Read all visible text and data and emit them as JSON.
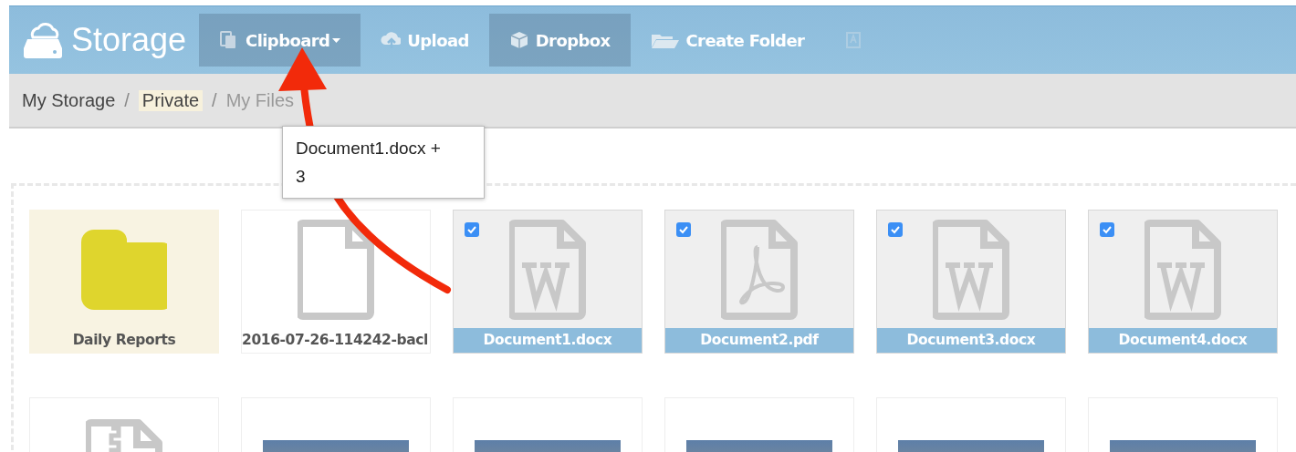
{
  "brand": {
    "title": "Storage"
  },
  "toolbar": [
    {
      "kind": "clipboard",
      "label": "Clipboard",
      "dropdown": true,
      "highlighted": true
    },
    {
      "kind": "upload",
      "label": "Upload",
      "dropdown": false,
      "highlighted": false
    },
    {
      "kind": "box",
      "label": "Dropbox",
      "dropdown": false,
      "highlighted": true
    },
    {
      "kind": "folder",
      "label": "Create Folder",
      "dropdown": false,
      "highlighted": false
    },
    {
      "kind": "translate",
      "highlighted": false,
      "disabled": true
    }
  ],
  "breadcrumb": [
    {
      "kind": "link",
      "label": "My Storage",
      "highlighted": false,
      "current": false
    },
    {
      "kind": "separator",
      "label": "/"
    },
    {
      "kind": "link",
      "label": "Private",
      "highlighted": true,
      "current": false
    },
    {
      "kind": "separator",
      "label": "/"
    },
    {
      "kind": "link",
      "label": "My Files",
      "highlighted": false,
      "current": true
    }
  ],
  "tooltip": {
    "text": "Document1.docx + 3"
  },
  "tiles": [
    {
      "kind": "folder",
      "label": "Daily Reports",
      "selected": false
    },
    {
      "kind": "file",
      "label": "2016-07-26-114242-bacl",
      "selected": false
    },
    {
      "kind": "word",
      "label": "Document1.docx",
      "selected": true
    },
    {
      "kind": "pdf",
      "label": "Document2.pdf",
      "selected": true
    },
    {
      "kind": "word",
      "label": "Document3.docx",
      "selected": true
    },
    {
      "kind": "word",
      "label": "Document4.docx",
      "selected": true
    },
    {
      "kind": "zip",
      "selected": false
    },
    {
      "kind": "image",
      "selected": false
    },
    {
      "kind": "image",
      "selected": false
    },
    {
      "kind": "image",
      "selected": false
    },
    {
      "kind": "image",
      "selected": false
    },
    {
      "kind": "image",
      "selected": false
    }
  ]
}
